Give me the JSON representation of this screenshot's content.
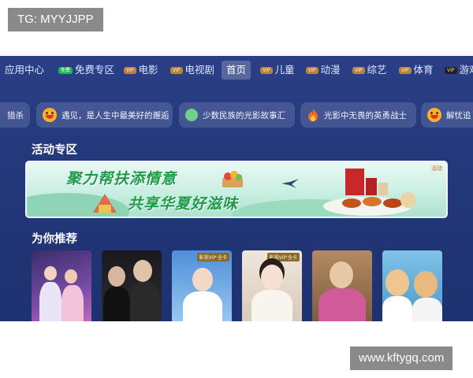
{
  "watermarks": {
    "top": "TG: MYYJJPP",
    "bottom": "www.kftygq.com"
  },
  "nav": [
    {
      "label": "应用中心",
      "badge": ""
    },
    {
      "label": "免费专区",
      "badge": "免费"
    },
    {
      "label": "电影",
      "badge": "VIP"
    },
    {
      "label": "电视剧",
      "badge": "VIP"
    },
    {
      "label": "首页",
      "badge": "",
      "active": true
    },
    {
      "label": "儿童",
      "badge": "VIP"
    },
    {
      "label": "动漫",
      "badge": "VIP"
    },
    {
      "label": "综艺",
      "badge": "VIP"
    },
    {
      "label": "体育",
      "badge": "VIP"
    },
    {
      "label": "游戏",
      "badge": "VIP"
    }
  ],
  "topics": [
    {
      "label": "猎杀",
      "icon": "smile-emoji-icon"
    },
    {
      "label": "遇见，是人生中最美好的邂逅",
      "icon": "smile-emoji-icon"
    },
    {
      "label": "少数民族的光影故事汇",
      "icon": "leaf-emoji-icon"
    },
    {
      "label": "光影中无畏的英勇战士",
      "icon": "flame-icon"
    },
    {
      "label": "解忧追",
      "icon": "smile-emoji-icon"
    }
  ],
  "sections": {
    "activity": "活动专区",
    "recommend": "为你推荐"
  },
  "banner": {
    "line1": "聚力帮扶添情意",
    "line2": "共享华夏好滋味",
    "tag": "活动"
  },
  "posters": [
    {
      "badge": ""
    },
    {
      "badge": ""
    },
    {
      "badge": "影视VIP·全卡"
    },
    {
      "badge": "影视VIP·全卡"
    },
    {
      "badge": ""
    },
    {
      "badge": ""
    }
  ],
  "colors": {
    "screen_bg": "#23387a",
    "accent_green": "#1f9a4a",
    "free_badge": "#1bb55b"
  }
}
